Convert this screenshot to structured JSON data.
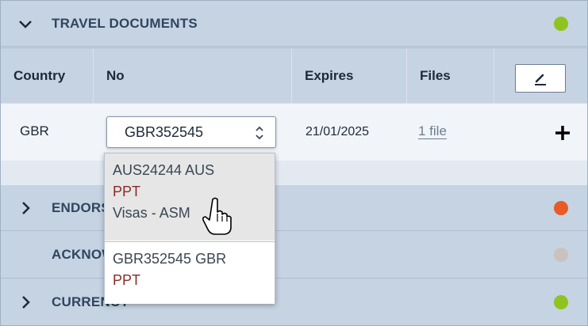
{
  "sections": {
    "travel": {
      "title": "TRAVEL DOCUMENTS",
      "status_color": "#8fc31f"
    },
    "endorsements": {
      "title": "ENDORSEMENTS",
      "status_color": "#e85a26"
    },
    "acknowledgements": {
      "title": "ACKNOWLEDGEMENTS",
      "status_color": "#c9c2c0"
    },
    "currency": {
      "title": "CURRENCY",
      "status_color": "#8fc31f"
    }
  },
  "table": {
    "headers": {
      "country": "Country",
      "no": "No",
      "expires": "Expires",
      "files": "Files"
    },
    "row": {
      "country": "GBR",
      "no_selected": "GBR352545",
      "expires": "21/01/2025",
      "files": "1 file"
    }
  },
  "dropdown": {
    "options": [
      {
        "number": "AUS24244 AUS",
        "kind": "PPT",
        "extra": "Visas - ASM"
      },
      {
        "number": "GBR352545 GBR",
        "kind": "PPT"
      }
    ]
  },
  "icons": {
    "chevron_down": "chevron-down-icon",
    "chevron_right": "chevron-right-icon",
    "edit": "pencil-icon",
    "add": "plus-icon",
    "select_arrows": "updown-arrows-icon",
    "cursor": "hand-pointer-icon"
  }
}
